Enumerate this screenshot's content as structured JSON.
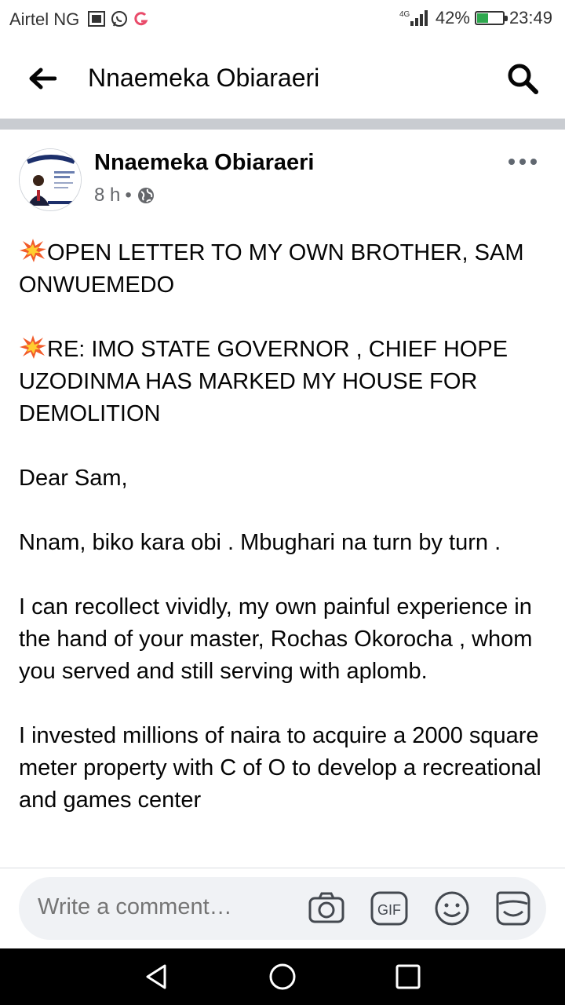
{
  "status_bar": {
    "carrier": "Airtel NG",
    "network": "4G",
    "battery": "42%",
    "battery_level": 0.42,
    "time": "23:49"
  },
  "header": {
    "title": "Nnaemeka Obiaraeri",
    "icons": [
      "back-arrow-icon",
      "search-icon"
    ]
  },
  "post": {
    "author": "Nnaemeka Obiaraeri",
    "time": "8 h",
    "separator": "•",
    "privacy_icon": "globe-icon",
    "paragraphs": [
      "OPEN LETTER TO MY OWN BROTHER,  SAM ONWUEMEDO",
      "RE: IMO STATE GOVERNOR , CHIEF HOPE UZODINMA HAS MARKED MY HOUSE FOR DEMOLITION",
      "Dear Sam,",
      "Nnam, biko kara obi . Mbughari  na turn by turn .",
      "I can recollect vividly, my own painful experience in the hand of your master,  Rochas Okorocha , whom  you served and still serving with aplomb.",
      "I invested millions of naira to acquire a 2000 square meter  property  with C of O  to develop a recreational and games center"
    ],
    "emoji_icon": "collision-emoji"
  },
  "comment_bar": {
    "placeholder": "Write a comment…",
    "icons": [
      "camera-icon",
      "gif-icon",
      "emoji-icon",
      "sticker-icon"
    ]
  },
  "colors": {
    "accent_text": "#050505",
    "muted": "#65676b",
    "divider": "#c9ccd1",
    "comment_bg": "#f0f2f5"
  }
}
